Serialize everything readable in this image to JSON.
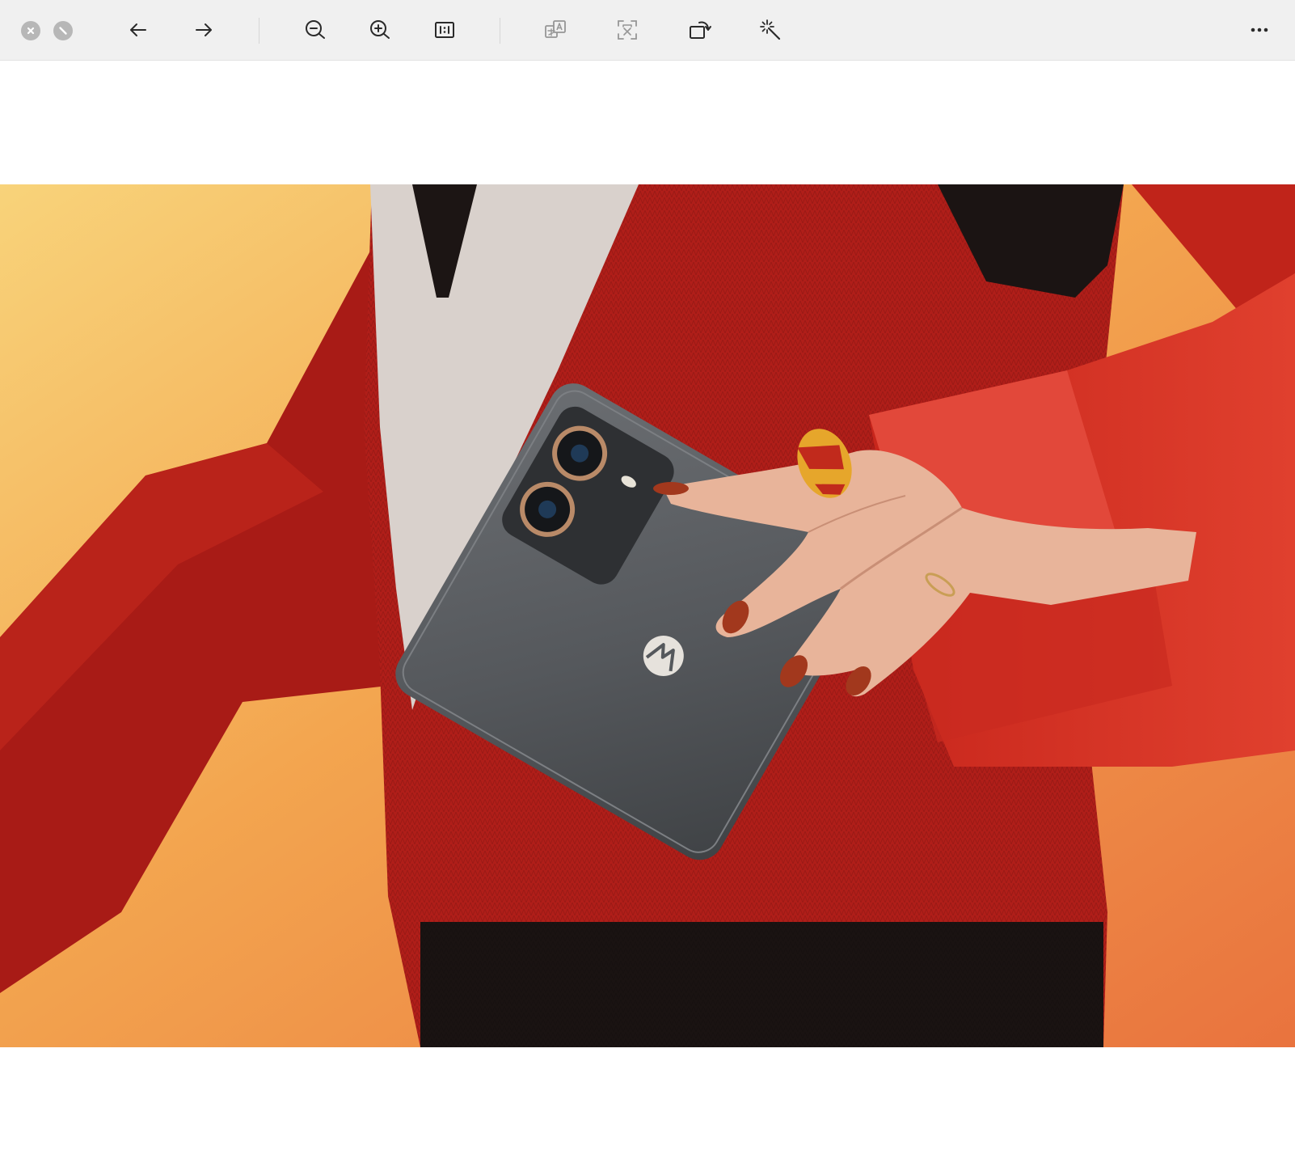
{
  "toolbar": {
    "window_controls": [
      {
        "icon": "close-icon"
      },
      {
        "icon": "stop-icon"
      }
    ],
    "nav": [
      {
        "icon": "arrow-left-icon"
      },
      {
        "icon": "arrow-right-icon"
      }
    ],
    "zoom": [
      {
        "icon": "zoom-out-icon"
      },
      {
        "icon": "zoom-in-icon"
      },
      {
        "icon": "actual-size-icon"
      }
    ],
    "tools": [
      {
        "icon": "translate-icon",
        "enabled": false
      },
      {
        "icon": "text-recognition-icon",
        "enabled": false
      },
      {
        "icon": "rotate-icon",
        "enabled": true
      },
      {
        "icon": "magic-wand-icon",
        "enabled": true
      }
    ],
    "more": {
      "icon": "more-horizontal-icon"
    }
  },
  "colors": {
    "toolbar_bg": "#f0f0f0",
    "icon": "#2a2a2a",
    "icon_disabled": "#8a8a8a",
    "window_button": "#b7b7b7"
  },
  "image": {
    "icon": "photo-image",
    "logo": "motorola-logo"
  }
}
